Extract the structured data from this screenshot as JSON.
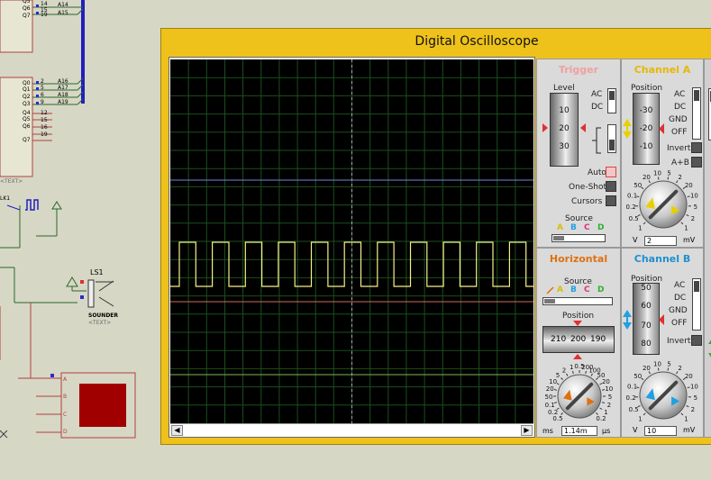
{
  "schematic": {
    "chip1_pins": [
      "Q5",
      "Q6",
      "Q7"
    ],
    "chip1_net_nums": [
      "14",
      "15",
      "19"
    ],
    "chip1_net_labels": [
      "A14",
      "A15"
    ],
    "chip2_pins": [
      "Q0",
      "Q1",
      "Q2",
      "Q3",
      "Q4",
      "Q5",
      "Q6",
      "Q7"
    ],
    "chip2_net_nums": [
      "2",
      "5",
      "6",
      "9",
      "12",
      "15",
      "16",
      "19"
    ],
    "chip2_net_labels": [
      "A16",
      "A17",
      "A18",
      "A19"
    ],
    "clk_label": "LK1",
    "sounder_ref": "LS1",
    "sounder_name": "SOUNDER",
    "sounder_text": "<TEXT>",
    "chip_text": "<TEXT>",
    "matrix_pins": [
      "A",
      "B",
      "C",
      "D"
    ]
  },
  "oscilloscope": {
    "title": "Digital Oscilloscope",
    "trigger": {
      "title": "Trigger",
      "level_label": "Level",
      "level_values": [
        "10",
        "20",
        "30"
      ],
      "coupling": [
        "AC",
        "DC"
      ],
      "modes": [
        "Auto",
        "One-Shot",
        "Cursors"
      ],
      "source_label": "Source",
      "source_letters": [
        "A",
        "B",
        "C",
        "D"
      ]
    },
    "horizontal": {
      "title": "Horizontal",
      "source_label": "Source",
      "source_letters": [
        "A",
        "B",
        "C",
        "D"
      ],
      "position_label": "Position",
      "position_values": [
        "210",
        "200",
        "190"
      ],
      "dial_scale": [
        "0.5",
        "0.2",
        "0.1",
        "50",
        "20",
        "10",
        "5",
        "2",
        "1",
        "0.5",
        "200",
        "100",
        "50",
        "20",
        "10",
        "5",
        "2",
        "1",
        "0.2"
      ],
      "unit_left": "ms",
      "readout": "1.14m",
      "unit_right": "µs"
    },
    "channel_a": {
      "title": "Channel A",
      "position_label": "Position",
      "position_values": [
        "-30",
        "-20",
        "-10"
      ],
      "coupling": [
        "AC",
        "DC",
        "GND",
        "OFF"
      ],
      "invert_label": "Invert",
      "aplusb_label": "A+B",
      "dial_scale": [
        "1",
        "0.5",
        "0.2",
        "0.1",
        "50",
        "20",
        "10",
        "5",
        "2",
        "20",
        "10",
        "5",
        "2",
        "1"
      ],
      "unit_left": "V",
      "readout": "2",
      "unit_right": "mV"
    },
    "channel_b": {
      "title": "Channel B",
      "position_label": "Position",
      "position_values": [
        "50",
        "60",
        "70",
        "80"
      ],
      "coupling": [
        "AC",
        "DC",
        "GND",
        "OFF"
      ],
      "invert_label": "Invert",
      "dial_scale": [
        "1",
        "0.5",
        "0.2",
        "0.1",
        "50",
        "20",
        "10",
        "5",
        "2",
        "20",
        "10",
        "5",
        "2",
        "1"
      ],
      "unit_left": "V",
      "readout": "10",
      "unit_right": "mV"
    },
    "colors": {
      "trace_a": "#f5f08a",
      "trace_b": "#6c8cd5",
      "trace_c": "#d46a5a",
      "trace_d": "#77bb55",
      "title_bar": "#eec21a"
    },
    "signal": {
      "periods_visible": 11,
      "duty": 0.5
    }
  }
}
